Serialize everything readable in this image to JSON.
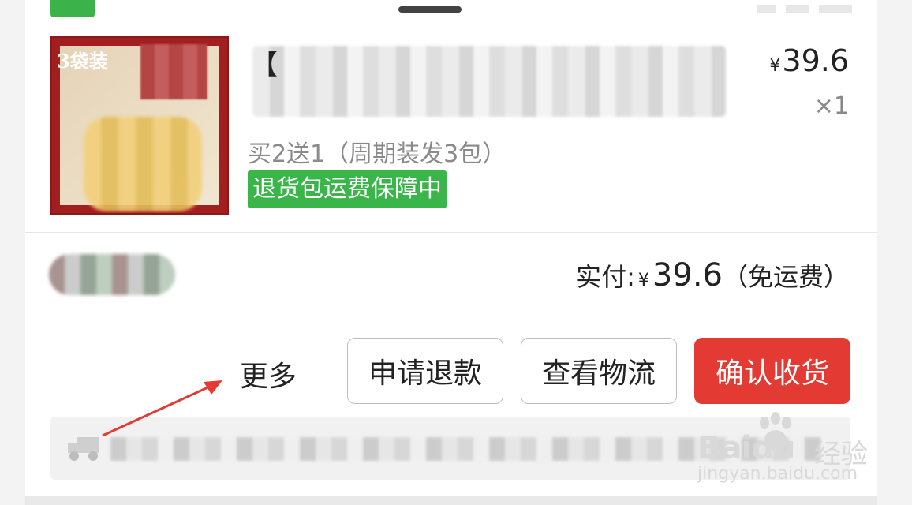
{
  "order": {
    "product": {
      "image_badge": "3袋装",
      "title_start": "【",
      "variant": "买2送1（周期装发3包）",
      "guarantee_tag": "退货包运费保障中",
      "price_currency": "¥",
      "price_value": "39.6",
      "quantity": "×1"
    },
    "payment": {
      "label": "实付:",
      "currency": "¥",
      "amount": "39.6",
      "shipping_note": "（免运费）"
    },
    "actions": {
      "more_label": "更多",
      "refund_label": "申请退款",
      "logistics_label": "查看物流",
      "confirm_label": "确认收货"
    }
  },
  "watermark": {
    "brand": "Baidu",
    "brand_cn": "经验",
    "url": "jingyan.baidu.com"
  },
  "colors": {
    "confirm_button": "#e33a34",
    "guarantee_tag": "#3ab54a",
    "annotation_arrow": "#e33a34"
  },
  "icons": [
    "truck-icon",
    "annotation-arrow",
    "baidu-paw-logo"
  ]
}
